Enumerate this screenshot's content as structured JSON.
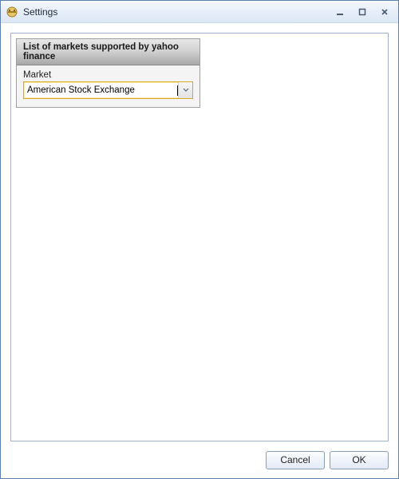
{
  "window": {
    "title": "Settings"
  },
  "group": {
    "header": "List of markets supported by yahoo finance",
    "market_label": "Market",
    "market_value": "American Stock Exchange"
  },
  "buttons": {
    "cancel": "Cancel",
    "ok": "OK"
  }
}
